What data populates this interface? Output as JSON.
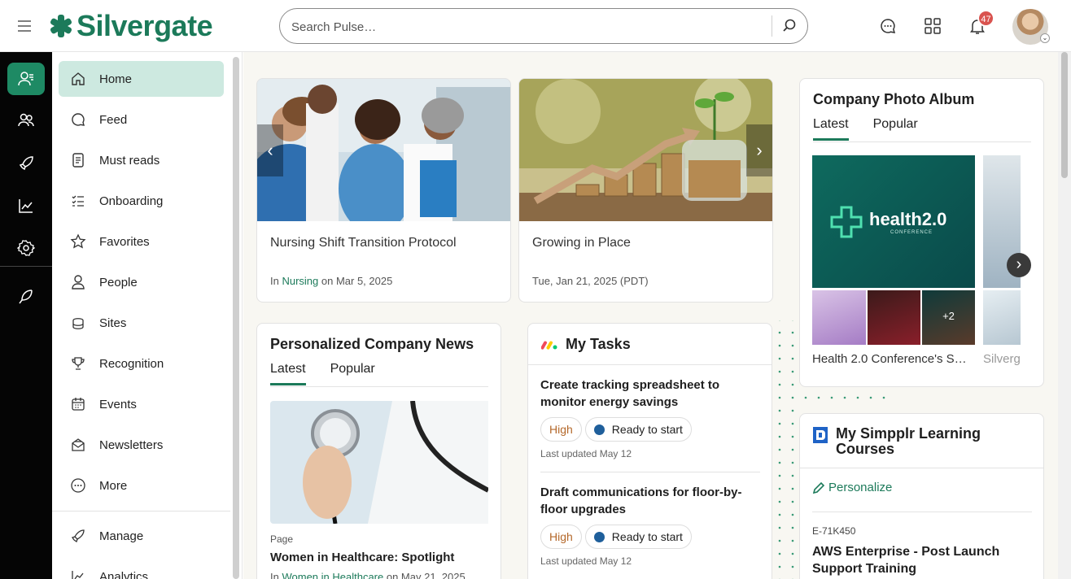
{
  "brand": {
    "name": "Silvergate",
    "color": "#1c7a5a"
  },
  "header": {
    "search_placeholder": "Search Pulse…",
    "notifications_count": "47"
  },
  "rail": {
    "icons": [
      "home-people-icon",
      "people-icon",
      "rocket-icon",
      "analytics-icon",
      "settings-icon",
      "feather-icon"
    ]
  },
  "sidebar": {
    "items": [
      {
        "label": "Home",
        "icon": "home-icon"
      },
      {
        "label": "Feed",
        "icon": "feed-icon"
      },
      {
        "label": "Must reads",
        "icon": "must-reads-icon"
      },
      {
        "label": "Onboarding",
        "icon": "onboarding-icon"
      },
      {
        "label": "Favorites",
        "icon": "star-icon"
      },
      {
        "label": "People",
        "icon": "person-icon"
      },
      {
        "label": "Sites",
        "icon": "sites-icon"
      },
      {
        "label": "Recognition",
        "icon": "trophy-icon"
      },
      {
        "label": "Events",
        "icon": "calendar-icon"
      },
      {
        "label": "Newsletters",
        "icon": "newsletter-icon"
      },
      {
        "label": "More",
        "icon": "more-icon"
      }
    ],
    "bottom_items": [
      {
        "label": "Manage",
        "icon": "rocket-icon"
      },
      {
        "label": "Analytics",
        "icon": "analytics-icon"
      }
    ]
  },
  "featured": [
    {
      "title": "Nursing Shift Transition Protocol",
      "meta_prefix": "In ",
      "meta_link": "Nursing",
      "meta_suffix": " on Mar 5, 2025"
    },
    {
      "title": "Growing in Place",
      "meta": "Tue, Jan 21, 2025 (PDT)"
    }
  ],
  "news": {
    "title": "Personalized Company News",
    "tabs": [
      "Latest",
      "Popular"
    ],
    "article": {
      "type": "Page",
      "title": "Women in Healthcare: Spotlight",
      "meta_prefix": "In ",
      "meta_link": "Women in Healthcare",
      "meta_suffix": " on May 21, 2025"
    }
  },
  "tasks": {
    "title": "My Tasks",
    "items": [
      {
        "title": "Create tracking spreadsheet to monitor energy savings",
        "priority": "High",
        "status": "Ready to start",
        "updated": "Last updated May 12"
      },
      {
        "title": "Draft communications for floor-by-floor upgrades",
        "priority": "High",
        "status": "Ready to start",
        "updated": "Last updated May 12"
      }
    ]
  },
  "album": {
    "title": "Company Photo Album",
    "tabs": [
      "Latest",
      "Popular"
    ],
    "cover_text": "health2.0",
    "cover_sub": "CONFERENCE",
    "more_count": "+2",
    "captions": [
      "Health 2.0 Conference's S…",
      "Silverg"
    ]
  },
  "learning": {
    "title": "My Simpplr Learning Courses",
    "personalize": "Personalize",
    "course_id": "E-71K450",
    "course_title": "AWS Enterprise - Post Launch Support Training"
  }
}
